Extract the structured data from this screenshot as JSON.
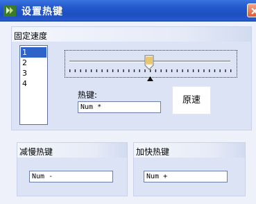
{
  "window": {
    "title": "设置热键",
    "accent": "#2359cc"
  },
  "icons": {
    "app": "app-icon",
    "close": "close-icon"
  },
  "fixed_speed": {
    "caption": "固定速度",
    "list_items": [
      "1",
      "2",
      "3",
      "4"
    ],
    "selected_index": 0,
    "slider_value_fraction": 0.5,
    "hotkey_label": "热键:",
    "hotkey_value": "Num *",
    "reset_label": "原速"
  },
  "slow_hotkey": {
    "caption": "减慢热键",
    "value": "Num -"
  },
  "fast_hotkey": {
    "caption": "加快热键",
    "value": "Num +"
  }
}
